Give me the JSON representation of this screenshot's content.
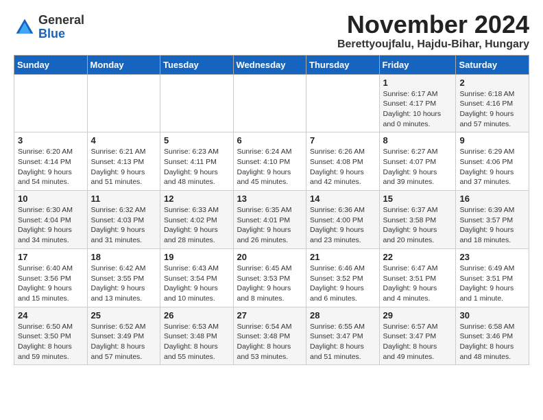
{
  "logo": {
    "general": "General",
    "blue": "Blue"
  },
  "header": {
    "month": "November 2024",
    "location": "Berettyoujfalu, Hajdu-Bihar, Hungary"
  },
  "weekdays": [
    "Sunday",
    "Monday",
    "Tuesday",
    "Wednesday",
    "Thursday",
    "Friday",
    "Saturday"
  ],
  "weeks": [
    [
      {
        "day": "",
        "info": ""
      },
      {
        "day": "",
        "info": ""
      },
      {
        "day": "",
        "info": ""
      },
      {
        "day": "",
        "info": ""
      },
      {
        "day": "",
        "info": ""
      },
      {
        "day": "1",
        "info": "Sunrise: 6:17 AM\nSunset: 4:17 PM\nDaylight: 10 hours\nand 0 minutes."
      },
      {
        "day": "2",
        "info": "Sunrise: 6:18 AM\nSunset: 4:16 PM\nDaylight: 9 hours\nand 57 minutes."
      }
    ],
    [
      {
        "day": "3",
        "info": "Sunrise: 6:20 AM\nSunset: 4:14 PM\nDaylight: 9 hours\nand 54 minutes."
      },
      {
        "day": "4",
        "info": "Sunrise: 6:21 AM\nSunset: 4:13 PM\nDaylight: 9 hours\nand 51 minutes."
      },
      {
        "day": "5",
        "info": "Sunrise: 6:23 AM\nSunset: 4:11 PM\nDaylight: 9 hours\nand 48 minutes."
      },
      {
        "day": "6",
        "info": "Sunrise: 6:24 AM\nSunset: 4:10 PM\nDaylight: 9 hours\nand 45 minutes."
      },
      {
        "day": "7",
        "info": "Sunrise: 6:26 AM\nSunset: 4:08 PM\nDaylight: 9 hours\nand 42 minutes."
      },
      {
        "day": "8",
        "info": "Sunrise: 6:27 AM\nSunset: 4:07 PM\nDaylight: 9 hours\nand 39 minutes."
      },
      {
        "day": "9",
        "info": "Sunrise: 6:29 AM\nSunset: 4:06 PM\nDaylight: 9 hours\nand 37 minutes."
      }
    ],
    [
      {
        "day": "10",
        "info": "Sunrise: 6:30 AM\nSunset: 4:04 PM\nDaylight: 9 hours\nand 34 minutes."
      },
      {
        "day": "11",
        "info": "Sunrise: 6:32 AM\nSunset: 4:03 PM\nDaylight: 9 hours\nand 31 minutes."
      },
      {
        "day": "12",
        "info": "Sunrise: 6:33 AM\nSunset: 4:02 PM\nDaylight: 9 hours\nand 28 minutes."
      },
      {
        "day": "13",
        "info": "Sunrise: 6:35 AM\nSunset: 4:01 PM\nDaylight: 9 hours\nand 26 minutes."
      },
      {
        "day": "14",
        "info": "Sunrise: 6:36 AM\nSunset: 4:00 PM\nDaylight: 9 hours\nand 23 minutes."
      },
      {
        "day": "15",
        "info": "Sunrise: 6:37 AM\nSunset: 3:58 PM\nDaylight: 9 hours\nand 20 minutes."
      },
      {
        "day": "16",
        "info": "Sunrise: 6:39 AM\nSunset: 3:57 PM\nDaylight: 9 hours\nand 18 minutes."
      }
    ],
    [
      {
        "day": "17",
        "info": "Sunrise: 6:40 AM\nSunset: 3:56 PM\nDaylight: 9 hours\nand 15 minutes."
      },
      {
        "day": "18",
        "info": "Sunrise: 6:42 AM\nSunset: 3:55 PM\nDaylight: 9 hours\nand 13 minutes."
      },
      {
        "day": "19",
        "info": "Sunrise: 6:43 AM\nSunset: 3:54 PM\nDaylight: 9 hours\nand 10 minutes."
      },
      {
        "day": "20",
        "info": "Sunrise: 6:45 AM\nSunset: 3:53 PM\nDaylight: 9 hours\nand 8 minutes."
      },
      {
        "day": "21",
        "info": "Sunrise: 6:46 AM\nSunset: 3:52 PM\nDaylight: 9 hours\nand 6 minutes."
      },
      {
        "day": "22",
        "info": "Sunrise: 6:47 AM\nSunset: 3:51 PM\nDaylight: 9 hours\nand 4 minutes."
      },
      {
        "day": "23",
        "info": "Sunrise: 6:49 AM\nSunset: 3:51 PM\nDaylight: 9 hours\nand 1 minute."
      }
    ],
    [
      {
        "day": "24",
        "info": "Sunrise: 6:50 AM\nSunset: 3:50 PM\nDaylight: 8 hours\nand 59 minutes."
      },
      {
        "day": "25",
        "info": "Sunrise: 6:52 AM\nSunset: 3:49 PM\nDaylight: 8 hours\nand 57 minutes."
      },
      {
        "day": "26",
        "info": "Sunrise: 6:53 AM\nSunset: 3:48 PM\nDaylight: 8 hours\nand 55 minutes."
      },
      {
        "day": "27",
        "info": "Sunrise: 6:54 AM\nSunset: 3:48 PM\nDaylight: 8 hours\nand 53 minutes."
      },
      {
        "day": "28",
        "info": "Sunrise: 6:55 AM\nSunset: 3:47 PM\nDaylight: 8 hours\nand 51 minutes."
      },
      {
        "day": "29",
        "info": "Sunrise: 6:57 AM\nSunset: 3:47 PM\nDaylight: 8 hours\nand 49 minutes."
      },
      {
        "day": "30",
        "info": "Sunrise: 6:58 AM\nSunset: 3:46 PM\nDaylight: 8 hours\nand 48 minutes."
      }
    ]
  ]
}
